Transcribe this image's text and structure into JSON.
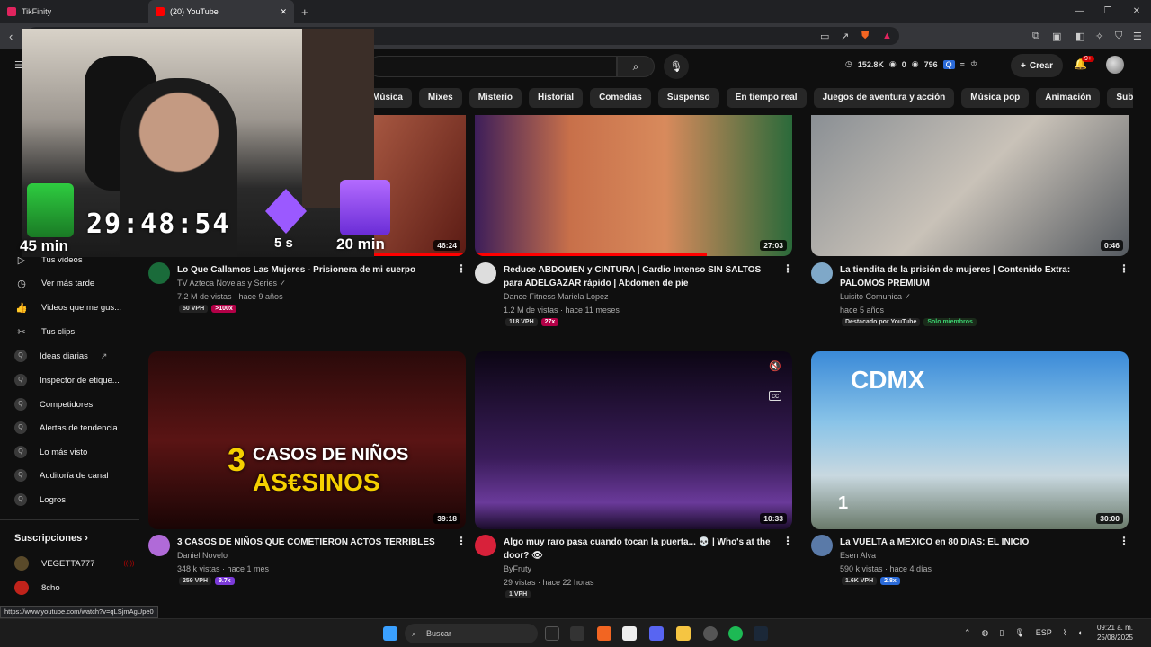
{
  "browser": {
    "tabs": [
      {
        "label": "TikFinity",
        "color": "#e0245e"
      },
      {
        "label": "(20) YouTube",
        "color": "#ff0000"
      }
    ],
    "new_tab": "+",
    "window_controls": [
      "—",
      "❐",
      "✕"
    ]
  },
  "yt_header": {
    "stats": {
      "a": "152.8K",
      "b": "0",
      "c": "796"
    },
    "create_label": "Crear",
    "notif_count": "9+"
  },
  "chips": [
    "Música",
    "Mixes",
    "Misterio",
    "Historial",
    "Comedias",
    "Suspenso",
    "En tiempo real",
    "Juegos de aventura y acción",
    "Música pop",
    "Animación",
    "Subidos recientemente"
  ],
  "overlay": {
    "timer": "29:48:54",
    "gift_label": "45 min",
    "gem_label": "5 s",
    "twitch_label": "20 min"
  },
  "sidebar": {
    "items": [
      {
        "label": "Tus videos",
        "icon": "▷"
      },
      {
        "label": "Ver más tarde",
        "icon": "◷"
      },
      {
        "label": "Videos que me gus...",
        "icon": "👍"
      },
      {
        "label": "Tus clips",
        "icon": "✂"
      },
      {
        "label": "Ideas diarias",
        "icon": "Q"
      },
      {
        "label": "Inspector de etique...",
        "icon": "Q"
      },
      {
        "label": "Competidores",
        "icon": "Q"
      },
      {
        "label": "Alertas de tendencia",
        "icon": "Q"
      },
      {
        "label": "Lo más visto",
        "icon": "Q"
      },
      {
        "label": "Auditoría de canal",
        "icon": "Q"
      },
      {
        "label": "Logros",
        "icon": "Q"
      }
    ],
    "subscriptions_title": "Suscripciones",
    "subscriptions": [
      {
        "label": "VEGETTA777",
        "color": "#5a4a2a"
      },
      {
        "label": "8cho",
        "color": "#c0231b"
      }
    ]
  },
  "videos": [
    {
      "title": "Lo Que Callamos Las Mujeres - Prisionera de mi cuerpo",
      "channel": "TV Azteca Novelas y Series ✓",
      "meta": "7.2 M de vistas · hace 9 años",
      "duration": "46:24",
      "vph": "50 VPH",
      "mult": ">100x",
      "mult_style": "mul",
      "thumb": "linear-gradient(120deg,#e8c7b0,#a0523d 60%,#5b1b14)",
      "av": "#1a6b3a"
    },
    {
      "title": "Reduce ABDOMEN y CINTURA | Cardio Intenso SIN SALTOS para ADELGAZAR rápido | Abdomen de pie",
      "channel": "Dance Fitness Mariela Lopez",
      "meta": "1.2 M de vistas · hace 11 meses",
      "duration": "27:03",
      "vph": "118 VPH",
      "mult": "27x",
      "mult_style": "mul",
      "thumb": "linear-gradient(90deg,#3d1e5a 0%,#c8704a 30%,#d88a5c 60%,#2a6a3a 100%)",
      "av": "#ddd"
    },
    {
      "title": "La tiendita de la prisión de mujeres | Contenido Extra: PALOMOS PREMIUM",
      "channel": "Luisito Comunica ✓",
      "meta": "hace 5 años",
      "duration": "0:46",
      "vph": "Destacado por YouTube",
      "mult": "Solo miembros",
      "mult_style": "green",
      "thumb": "linear-gradient(135deg,#8a8f94,#c9c2b8 50%,#555a60)",
      "av": "#7fa8c8"
    },
    {
      "title": "3 CASOS DE NIÑOS QUE COMETIERON ACTOS TERRIBLES",
      "channel": "Daniel Novelo",
      "meta": "348 k vistas · hace 1 mes",
      "duration": "39:18",
      "vph": "259 VPH",
      "mult": "9.7x",
      "mult_style": "mul purple",
      "thumb": "linear-gradient(180deg,#2a0a0a,#5a1414 50%,#1a0505)",
      "av": "#b06ad8"
    },
    {
      "title": "Algo muy raro pasa cuando tocan la puerta... 💀 | Who's at the door? 👁",
      "channel": "ByFruty",
      "meta": "29 vistas · hace 22 horas",
      "duration": "10:33",
      "vph": "1 VPH",
      "mult": "",
      "mult_style": "mul",
      "thumb": "linear-gradient(180deg,#0c0614,#3a1c5a 60%,#6a3a9a 85%,#1a0c2a)",
      "av": "#d8213a"
    },
    {
      "title": "La VUELTA a MEXICO en 80 DIAS: EL INICIO",
      "channel": "Esen Alva",
      "meta": "590 k vistas · hace 4 días",
      "duration": "30:00",
      "vph": "1.6K VPH",
      "mult": "2.8x",
      "mult_style": "mul blue",
      "thumb": "linear-gradient(180deg,#3a8ad8,#8ac4e8 40%,#c8d8e0 70%,#6a7a6a)",
      "av": "#5a7aa8"
    }
  ],
  "thumb_text": {
    "cdmx": "CDMX",
    "casos_1": "3",
    "casos_2": "CASOS DE NIÑOS",
    "casos_3": "AS€SINOS",
    "badge_1": "1"
  },
  "status_url": "https://www.youtube.com/watch?v=qLSjmAgUpe0",
  "taskbar": {
    "search_label": "Buscar",
    "lang": "ESP",
    "time": "09:21 a. m.",
    "date": "25/08/2025"
  }
}
